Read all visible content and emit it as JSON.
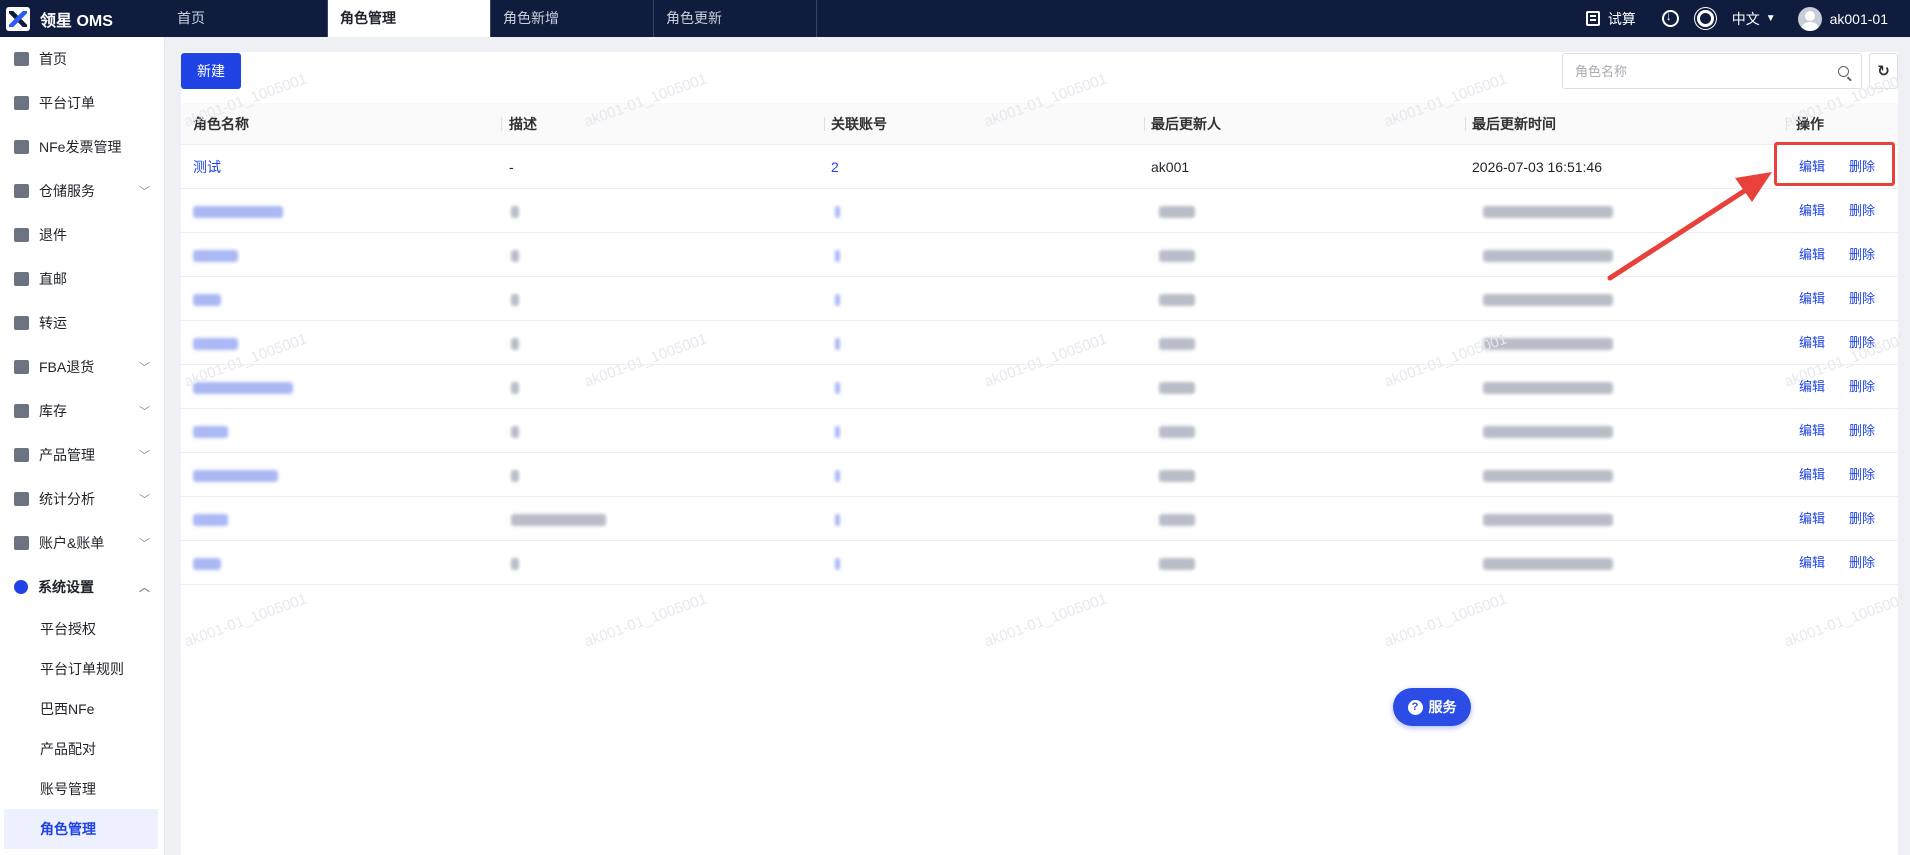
{
  "app": {
    "brand": "领星 OMS"
  },
  "topbar": {
    "tabs": [
      "首页",
      "角色管理",
      "角色新增",
      "角色更新"
    ],
    "active_tab": 1,
    "calc_label": "试算",
    "lang_label": "中文",
    "user": "ak001-01"
  },
  "sidebar": {
    "items": [
      {
        "label": "首页",
        "icon": "home-icon"
      },
      {
        "label": "平台订单",
        "icon": "order-icon"
      },
      {
        "label": "NFe发票管理",
        "icon": "invoice-icon"
      },
      {
        "label": "仓储服务",
        "icon": "warehouse-icon",
        "chevron": true
      },
      {
        "label": "退件",
        "icon": "return-icon"
      },
      {
        "label": "直邮",
        "icon": "mail-icon"
      },
      {
        "label": "转运",
        "icon": "transfer-icon"
      },
      {
        "label": "FBA退货",
        "icon": "fba-icon",
        "chevron": true
      },
      {
        "label": "库存",
        "icon": "inventory-icon",
        "chevron": true
      },
      {
        "label": "产品管理",
        "icon": "product-icon",
        "chevron": true
      },
      {
        "label": "统计分析",
        "icon": "chart-icon",
        "chevron": true
      },
      {
        "label": "账户&账单",
        "icon": "account-icon",
        "chevron": true
      },
      {
        "label": "系统设置",
        "icon": "settings-icon",
        "chevron": true,
        "open": true
      }
    ],
    "sub_items": [
      "平台授权",
      "平台订单规则",
      "巴西NFe",
      "产品配对",
      "账号管理",
      "角色管理"
    ],
    "active_sub": 5
  },
  "toolbar": {
    "new_label": "新建",
    "search_placeholder": "角色名称"
  },
  "table": {
    "headers": [
      "角色名称",
      "描述",
      "关联账号",
      "最后更新人",
      "最后更新时间",
      "操作"
    ],
    "first_row": {
      "name": "测试",
      "desc": "-",
      "accounts": "2",
      "updater": "ak001",
      "updated_at": "2026-07-03 16:51:46"
    },
    "edit_label": "编辑",
    "delete_label": "删除"
  },
  "watermark": "ak001-01_1005001",
  "service_label": "服务",
  "colors": {
    "accent": "#1f43e5",
    "topbar": "#0f1c3d",
    "highlight": "#e8413a"
  }
}
